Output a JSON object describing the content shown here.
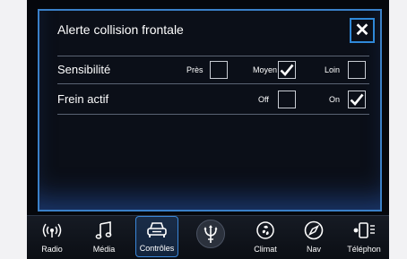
{
  "dialog": {
    "title": "Alerte collision frontale",
    "close_glyph": "✕"
  },
  "rows": [
    {
      "label": "Sensibilité",
      "options": [
        {
          "label": "Près",
          "checked": false
        },
        {
          "label": "Moyen",
          "checked": true
        },
        {
          "label": "Loin",
          "checked": false
        }
      ]
    },
    {
      "label": "Frein actif",
      "options": [
        {
          "label": "Off",
          "checked": false
        },
        {
          "label": "On",
          "checked": true
        }
      ]
    }
  ],
  "navbar": {
    "active": "Contrôles",
    "items": [
      {
        "label": "Radio",
        "icon": "radio-icon"
      },
      {
        "label": "Média",
        "icon": "music-note-icon"
      },
      {
        "label": "Contrôles",
        "icon": "car-icon"
      },
      {
        "label": "",
        "icon": "trident-icon"
      },
      {
        "label": "Climat",
        "icon": "climate-fan-icon"
      },
      {
        "label": "Nav",
        "icon": "compass-icon"
      },
      {
        "label": "Téléphon",
        "icon": "phone-icon"
      }
    ]
  },
  "colors": {
    "accent": "#3a86d8",
    "panel_bg": "#0b0f18",
    "text": "#ffffff"
  }
}
